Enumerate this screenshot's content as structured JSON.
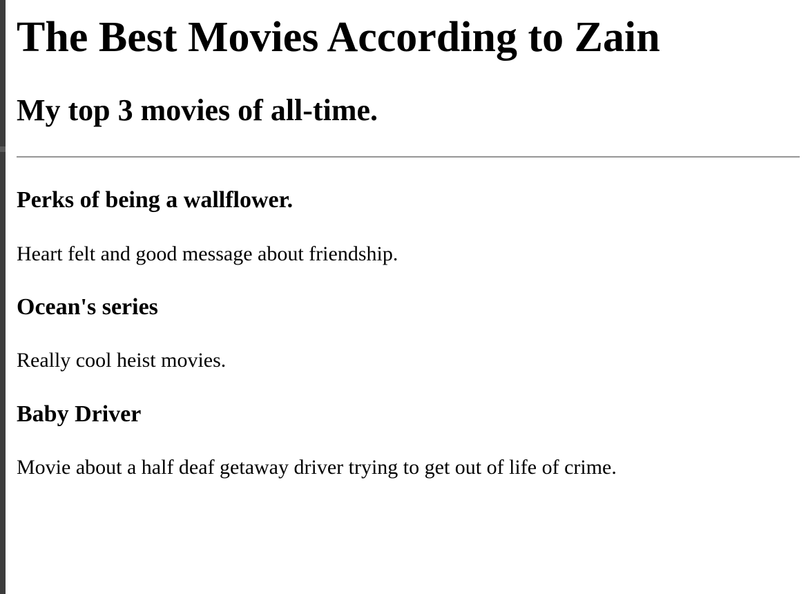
{
  "page": {
    "title": "The Best Movies According to Zain",
    "subtitle": "My top 3 movies of all-time."
  },
  "movies": [
    {
      "title": "Perks of being a wallflower.",
      "description": "Heart felt and good message about friendship."
    },
    {
      "title": "Ocean's series",
      "description": "Really cool heist movies."
    },
    {
      "title": "Baby Driver",
      "description": "Movie about a half deaf getaway driver trying to get out of life of crime."
    }
  ]
}
